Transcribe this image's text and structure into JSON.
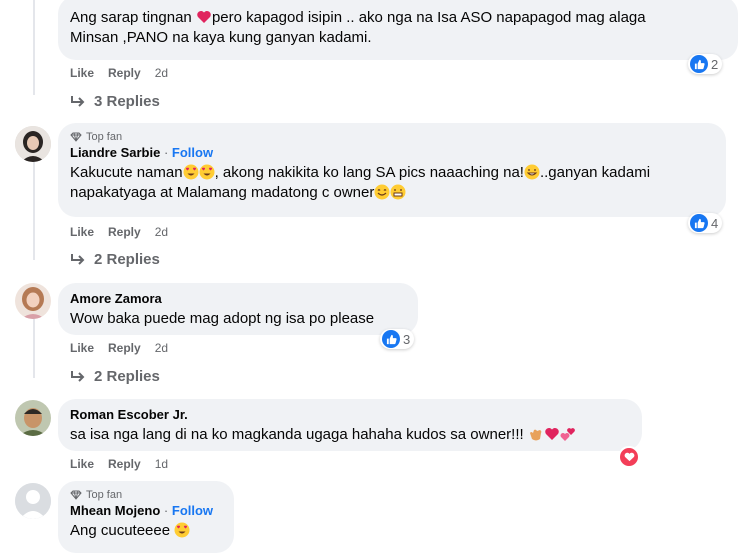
{
  "comments": [
    {
      "text_part1": "Ang sarap tingnan",
      "text_part2": "pero kapagod isipin .. ako nga na Isa ASO napapagod mag alaga",
      "text_line2": "Minsan ,PANO na kaya kung ganyan kadami.",
      "like": "Like",
      "reply": "Reply",
      "time": "2d",
      "reaction_count": "2",
      "replies": "3 Replies"
    },
    {
      "badge": "Top fan",
      "name": "Liandre Sarbie",
      "separator": "·",
      "follow": "Follow",
      "text_part1": "Kakucute naman",
      "text_part2": ", akong nakikita ko lang SA pics naaaching na!",
      "text_part3": "..ganyan kadami",
      "text_line2": "napakatyaga at Malamang madatong c owner",
      "like": "Like",
      "reply": "Reply",
      "time": "2d",
      "reaction_count": "4",
      "replies": "2 Replies"
    },
    {
      "name": "Amore Zamora",
      "text": "Wow baka puede mag adopt ng isa po please",
      "like": "Like",
      "reply": "Reply",
      "time": "2d",
      "reaction_count": "3",
      "replies": "2 Replies"
    },
    {
      "name": "Roman Escober Jr.",
      "text": "sa isa nga lang di na ko magkanda ugaga hahaha kudos sa owner!!!",
      "like": "Like",
      "reply": "Reply",
      "time": "1d"
    },
    {
      "badge": "Top fan",
      "name": "Mhean Mojeno",
      "separator": "·",
      "follow": "Follow",
      "text": "Ang cucuteeee"
    }
  ],
  "colors": {
    "like_blue": "#1877f2",
    "heart_red": "#f33e58",
    "bubble": "#f0f2f5",
    "muted": "#65676b"
  }
}
